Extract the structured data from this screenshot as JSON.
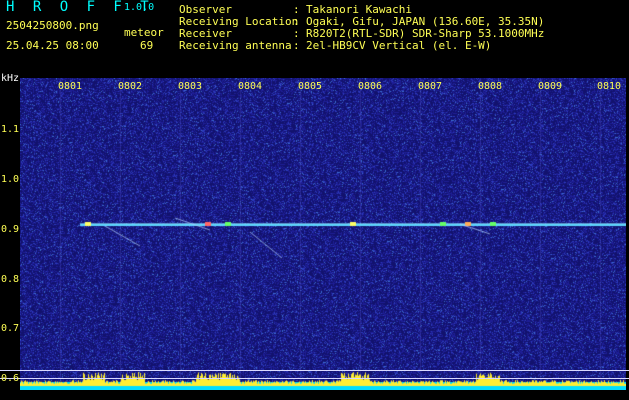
{
  "header": {
    "app_title": "H R O F F T",
    "version": "1.0.0",
    "file_name": "2504250800.png",
    "mode": "meteor",
    "datetime": "25.04.25 08:00",
    "count": "69"
  },
  "info": [
    {
      "label": "Observer",
      "value": "Takanori Kawachi"
    },
    {
      "label": "Receiving Location",
      "value": "Ogaki, Gifu, JAPAN (136.60E, 35.35N)"
    },
    {
      "label": "Receiver",
      "value": "R820T2(RTL-SDR) SDR-Sharp 53.1000MHz"
    },
    {
      "label": "Receiving antenna",
      "value": "2el-HB9CV Vertical (el. E-W)"
    }
  ],
  "axis": {
    "y_unit": "kHz",
    "time_ticks": [
      "0801",
      "0802",
      "0803",
      "0804",
      "0805",
      "0806",
      "0807",
      "0808",
      "0809",
      "0810"
    ],
    "freq_ticks": [
      "1.1",
      "1.0",
      "0.9",
      "0.8",
      "0.7",
      "0.6"
    ]
  },
  "colors": {
    "background": "#000000",
    "label_yellow": "#ffff55",
    "title_cyan": "#00ffff",
    "noise_blue": "#1a1a8c",
    "carrier_line": "#66e0ff"
  }
}
